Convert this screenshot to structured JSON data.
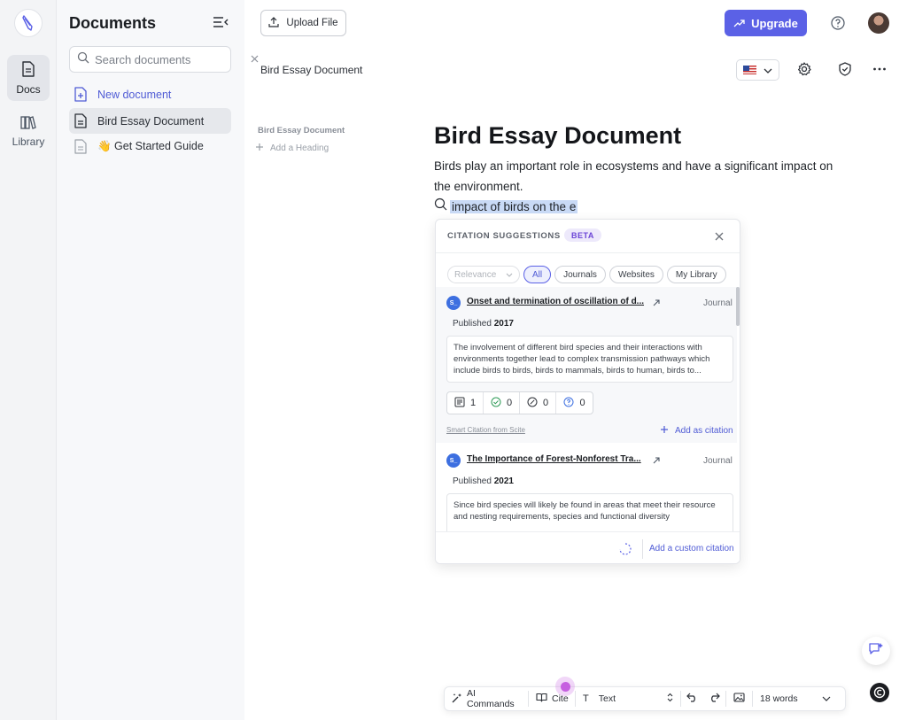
{
  "rail": {
    "items": [
      {
        "label": "Docs",
        "icon": "document-icon",
        "active": true
      },
      {
        "label": "Library",
        "icon": "books-icon",
        "active": false
      }
    ]
  },
  "sidebar": {
    "title": "Documents",
    "search_placeholder": "Search documents",
    "items": [
      {
        "label": "New document",
        "icon": "new-doc-icon"
      },
      {
        "label": "Bird Essay Document",
        "icon": "doc-icon",
        "active": true
      },
      {
        "label": "👋 Get Started Guide",
        "icon": "doc-outline-icon"
      }
    ]
  },
  "header": {
    "upload_label": "Upload File",
    "upgrade_label": "Upgrade",
    "doc_name": "Bird Essay Document",
    "language": "US flag"
  },
  "outline": {
    "title": "Bird Essay Document",
    "add_heading": "Add a Heading"
  },
  "editor": {
    "heading": "Bird Essay Document",
    "paragraph": "Birds play an important role in ecosystems and have a significant impact on the environment.",
    "query": "impact of birds on the e"
  },
  "citations": {
    "title": "CITATION SUGGESTIONS",
    "beta": "BETA",
    "sort": "Relevance",
    "filters": [
      "All",
      "Journals",
      "Websites",
      "My Library"
    ],
    "active_filter": "All",
    "results": [
      {
        "badge": "S_",
        "title": "Onset and termination of oscillation of d...",
        "type": "Journal",
        "published_label": "Published",
        "year": "2017",
        "snippet": "The involvement of different bird species and their interactions with environments together lead to complex transmission pathways which include birds to birds, birds to mammals, birds to human, birds to...",
        "stats": {
          "supporting_docs": "1",
          "supporting": "0",
          "contrasting": "0",
          "mentioning": "0"
        },
        "smart_citation": "Smart Citation from Scite",
        "add_label": "Add as citation"
      },
      {
        "badge": "S_",
        "title": "The Importance of Forest-Nonforest Tra...",
        "type": "Journal",
        "published_label": "Published",
        "year": "2021",
        "snippet": "Since bird species will likely be found in areas that meet their resource and nesting requirements, species and functional diversity"
      }
    ],
    "custom_citation": "Add a custom citation"
  },
  "toolbar": {
    "ai_commands": "AI Commands",
    "cite": "Cite",
    "text_style": "Text",
    "word_count": "18 words"
  },
  "colors": {
    "accent": "#5b61e6",
    "link": "#4f5bd5",
    "selection": "#c9daf6",
    "beta_bg": "#ede9fb"
  }
}
